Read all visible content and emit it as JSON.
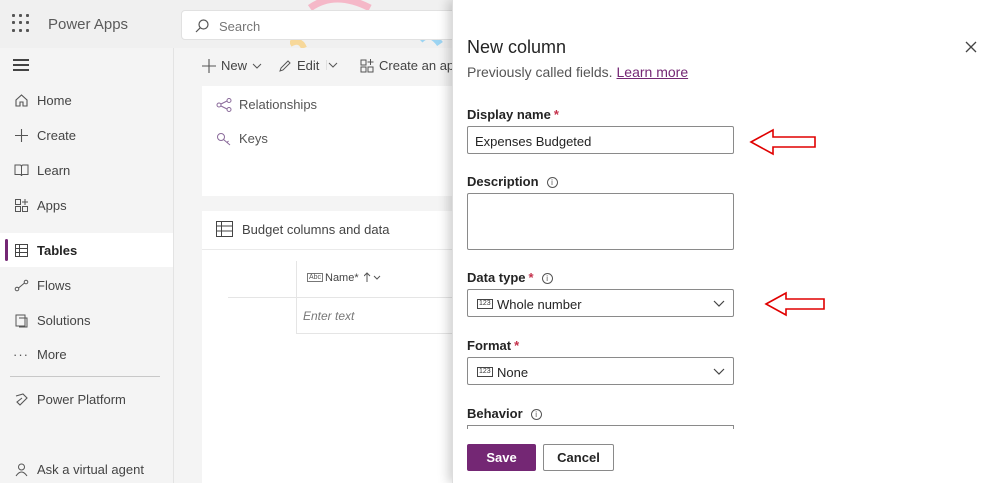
{
  "header": {
    "app_title": "Power Apps",
    "search_placeholder": "Search"
  },
  "leftnav": {
    "items": [
      {
        "label": "Home",
        "icon": "home-icon"
      },
      {
        "label": "Create",
        "icon": "plus-icon"
      },
      {
        "label": "Learn",
        "icon": "book-icon"
      },
      {
        "label": "Apps",
        "icon": "apps-icon"
      },
      {
        "label": "Tables",
        "icon": "table-icon",
        "active": true
      },
      {
        "label": "Flows",
        "icon": "flow-icon"
      },
      {
        "label": "Solutions",
        "icon": "solutions-icon"
      },
      {
        "label": "More",
        "icon": "more-icon"
      },
      {
        "label": "Power Platform",
        "icon": "power-platform-icon"
      },
      {
        "label": "Ask a virtual agent",
        "icon": "agent-icon"
      }
    ]
  },
  "commandbar": {
    "new_label": "New",
    "edit_label": "Edit",
    "create_app_label": "Create an app"
  },
  "table_card": {
    "relationships_label": "Relationships",
    "keys_label": "Keys",
    "data_title": "Budget columns and data",
    "column_header": "Name",
    "column_required_mark": "*",
    "cell_placeholder": "Enter text"
  },
  "panel": {
    "title": "New column",
    "subtitle": "Previously called fields.",
    "learn_more": "Learn more",
    "display_name_label": "Display name",
    "display_name_value": "Expenses Budgeted",
    "description_label": "Description",
    "description_value": "",
    "data_type_label": "Data type",
    "data_type_value": "Whole number",
    "format_label": "Format",
    "format_value": "None",
    "behavior_label": "Behavior",
    "required_mark": "*",
    "type_icon_text": "123",
    "save_label": "Save",
    "cancel_label": "Cancel"
  },
  "colors": {
    "accent": "#742774",
    "annotation_arrow": "#e00000"
  }
}
